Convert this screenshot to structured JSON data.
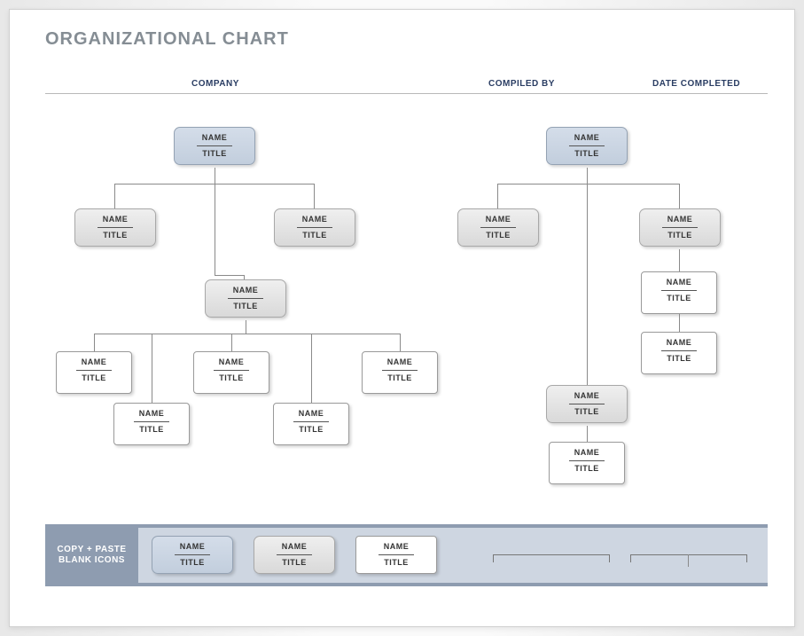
{
  "page_title": "ORGANIZATIONAL CHART",
  "columns": {
    "company": "COMPANY",
    "compiled": "COMPILED BY",
    "date": "DATE COMPLETED"
  },
  "placeholder": {
    "name": "NAME",
    "title": "TITLE"
  },
  "iconbar": {
    "label_line1": "COPY + PASTE",
    "label_line2": "BLANK ICONS"
  },
  "chart_data": {
    "type": "tree",
    "trees": [
      {
        "root": {
          "name": "NAME",
          "title": "TITLE",
          "style": "blue",
          "children": [
            {
              "name": "NAME",
              "title": "TITLE",
              "style": "grey"
            },
            {
              "name": "NAME",
              "title": "TITLE",
              "style": "grey",
              "children": [
                {
                  "name": "NAME",
                  "title": "TITLE",
                  "style": "grey",
                  "children": [
                    {
                      "name": "NAME",
                      "title": "TITLE",
                      "style": "white"
                    },
                    {
                      "name": "NAME",
                      "title": "TITLE",
                      "style": "white"
                    },
                    {
                      "name": "NAME",
                      "title": "TITLE",
                      "style": "white"
                    },
                    {
                      "name": "NAME",
                      "title": "TITLE",
                      "style": "white"
                    },
                    {
                      "name": "NAME",
                      "title": "TITLE",
                      "style": "white"
                    }
                  ]
                }
              ]
            }
          ]
        }
      },
      {
        "root": {
          "name": "NAME",
          "title": "TITLE",
          "style": "blue",
          "children": [
            {
              "name": "NAME",
              "title": "TITLE",
              "style": "grey"
            },
            {
              "name": "NAME",
              "title": "TITLE",
              "style": "grey",
              "children": [
                {
                  "name": "NAME",
                  "title": "TITLE",
                  "style": "white"
                },
                {
                  "name": "NAME",
                  "title": "TITLE",
                  "style": "white",
                  "children": [
                    {
                      "name": "NAME",
                      "title": "TITLE",
                      "style": "grey",
                      "children": [
                        {
                          "name": "NAME",
                          "title": "TITLE",
                          "style": "white"
                        }
                      ]
                    }
                  ]
                }
              ]
            }
          ]
        }
      }
    ],
    "palette_styles": [
      "blue",
      "grey",
      "white"
    ]
  }
}
